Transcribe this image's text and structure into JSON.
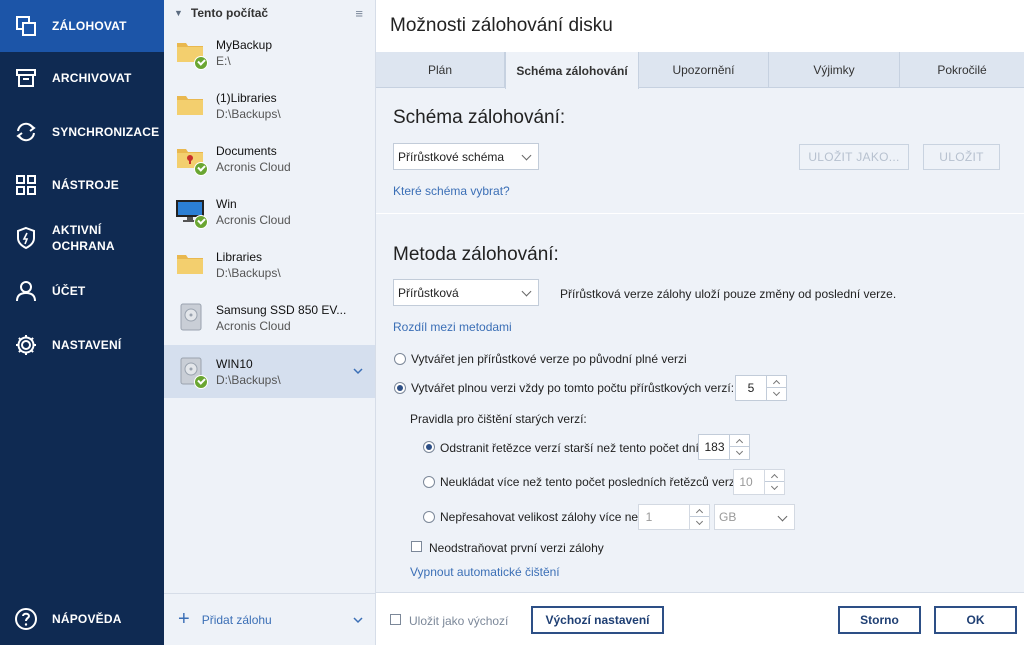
{
  "nav": {
    "items": [
      {
        "label": "ZÁLOHOVAT",
        "icon": "copy-icon"
      },
      {
        "label": "ARCHIVOVAT",
        "icon": "archive-icon"
      },
      {
        "label": "SYNCHRONIZACE",
        "icon": "sync-icon"
      },
      {
        "label": "NÁSTROJE",
        "icon": "grid-icon"
      },
      {
        "label": "AKTIVNÍ",
        "label2": "OCHRANA",
        "icon": "shield-icon"
      },
      {
        "label": "ÚČET",
        "icon": "user-icon"
      },
      {
        "label": "NASTAVENÍ",
        "icon": "gear-icon"
      }
    ],
    "help": {
      "label": "NÁPOVĚDA",
      "icon": "help-icon"
    }
  },
  "list": {
    "header": "Tento počítač",
    "items": [
      {
        "name": "MyBackup",
        "location": "E:\\",
        "icon": "folder-icon"
      },
      {
        "name": "(1)Libraries",
        "location": "D:\\Backups\\",
        "icon": "folder-icon"
      },
      {
        "name": "Documents",
        "location": "Acronis Cloud",
        "icon": "locked-folder-icon"
      },
      {
        "name": "Win",
        "location": "Acronis Cloud",
        "icon": "monitor-icon"
      },
      {
        "name": "Libraries",
        "location": "D:\\Backups\\",
        "icon": "folder-icon"
      },
      {
        "name": "Samsung SSD 850 EV...",
        "location": "Acronis Cloud",
        "icon": "disk-icon"
      },
      {
        "name": "WIN10",
        "location": "D:\\Backups\\",
        "icon": "disk-icon"
      }
    ],
    "add_label": "Přidat zálohu"
  },
  "main": {
    "title": "Možnosti zálohování disku",
    "tabs": [
      "Plán",
      "Schéma zálohování",
      "Upozornění",
      "Výjimky",
      "Pokročilé"
    ],
    "scheme": {
      "heading": "Schéma zálohování:",
      "selected": "Přírůstkové schéma",
      "save_as": "ULOŽIT JAKO...",
      "save": "ULOŽIT",
      "help_link": "Které schéma vybrat?"
    },
    "method": {
      "heading": "Metoda zálohování:",
      "selected": "Přírůstková",
      "description": "Přírůstková verze zálohy uloží pouze změny od poslední verze.",
      "diff_link": "Rozdíl mezi metodami",
      "opt1": "Vytvářet jen přírůstkové verze po původní plné verzi",
      "opt2": "Vytvářet plnou verzi vždy po tomto počtu přírůstkových verzí:",
      "opt2_value": "5",
      "cleanup_heading": "Pravidla pro čištění starých verzí:",
      "rule1": "Odstranit řetězce verzí starší než tento počet dní:",
      "rule1_value": "183",
      "rule2": "Neukládat více než tento počet posledních řetězců verzí:",
      "rule2_value": "10",
      "rule3": "Nepřesahovat velikost zálohy více než",
      "rule3_value": "1",
      "rule3_unit": "GB",
      "keep_first": "Neodstraňovat první verzi zálohy",
      "disable_link": "Vypnout automatické čištění"
    },
    "footer": {
      "save_default": "Uložit jako výchozí",
      "defaults": "Výchozí nastavení",
      "cancel": "Storno",
      "ok": "OK"
    }
  }
}
